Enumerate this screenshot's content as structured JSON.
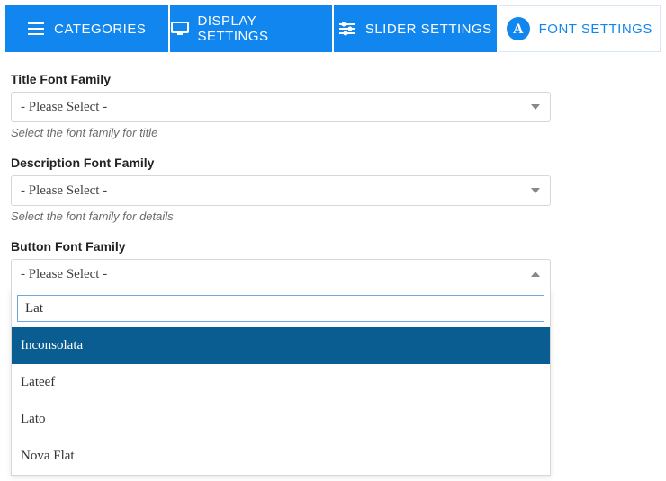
{
  "tabs": {
    "categories": "CATEGORIES",
    "display": "DISPLAY SETTINGS",
    "slider": "SLIDER SETTINGS",
    "font": "FONT SETTINGS"
  },
  "fields": {
    "title": {
      "label": "Title Font Family",
      "value": "- Please Select -",
      "help": "Select the font family for title"
    },
    "description": {
      "label": "Description Font Family",
      "value": "- Please Select -",
      "help": "Select the font family for details"
    },
    "button": {
      "label": "Button Font Family",
      "value": "- Please Select -",
      "search": "Lat",
      "options": {
        "0": "Inconsolata",
        "1": "Lateef",
        "2": "Lato",
        "3": "Nova Flat"
      }
    }
  }
}
